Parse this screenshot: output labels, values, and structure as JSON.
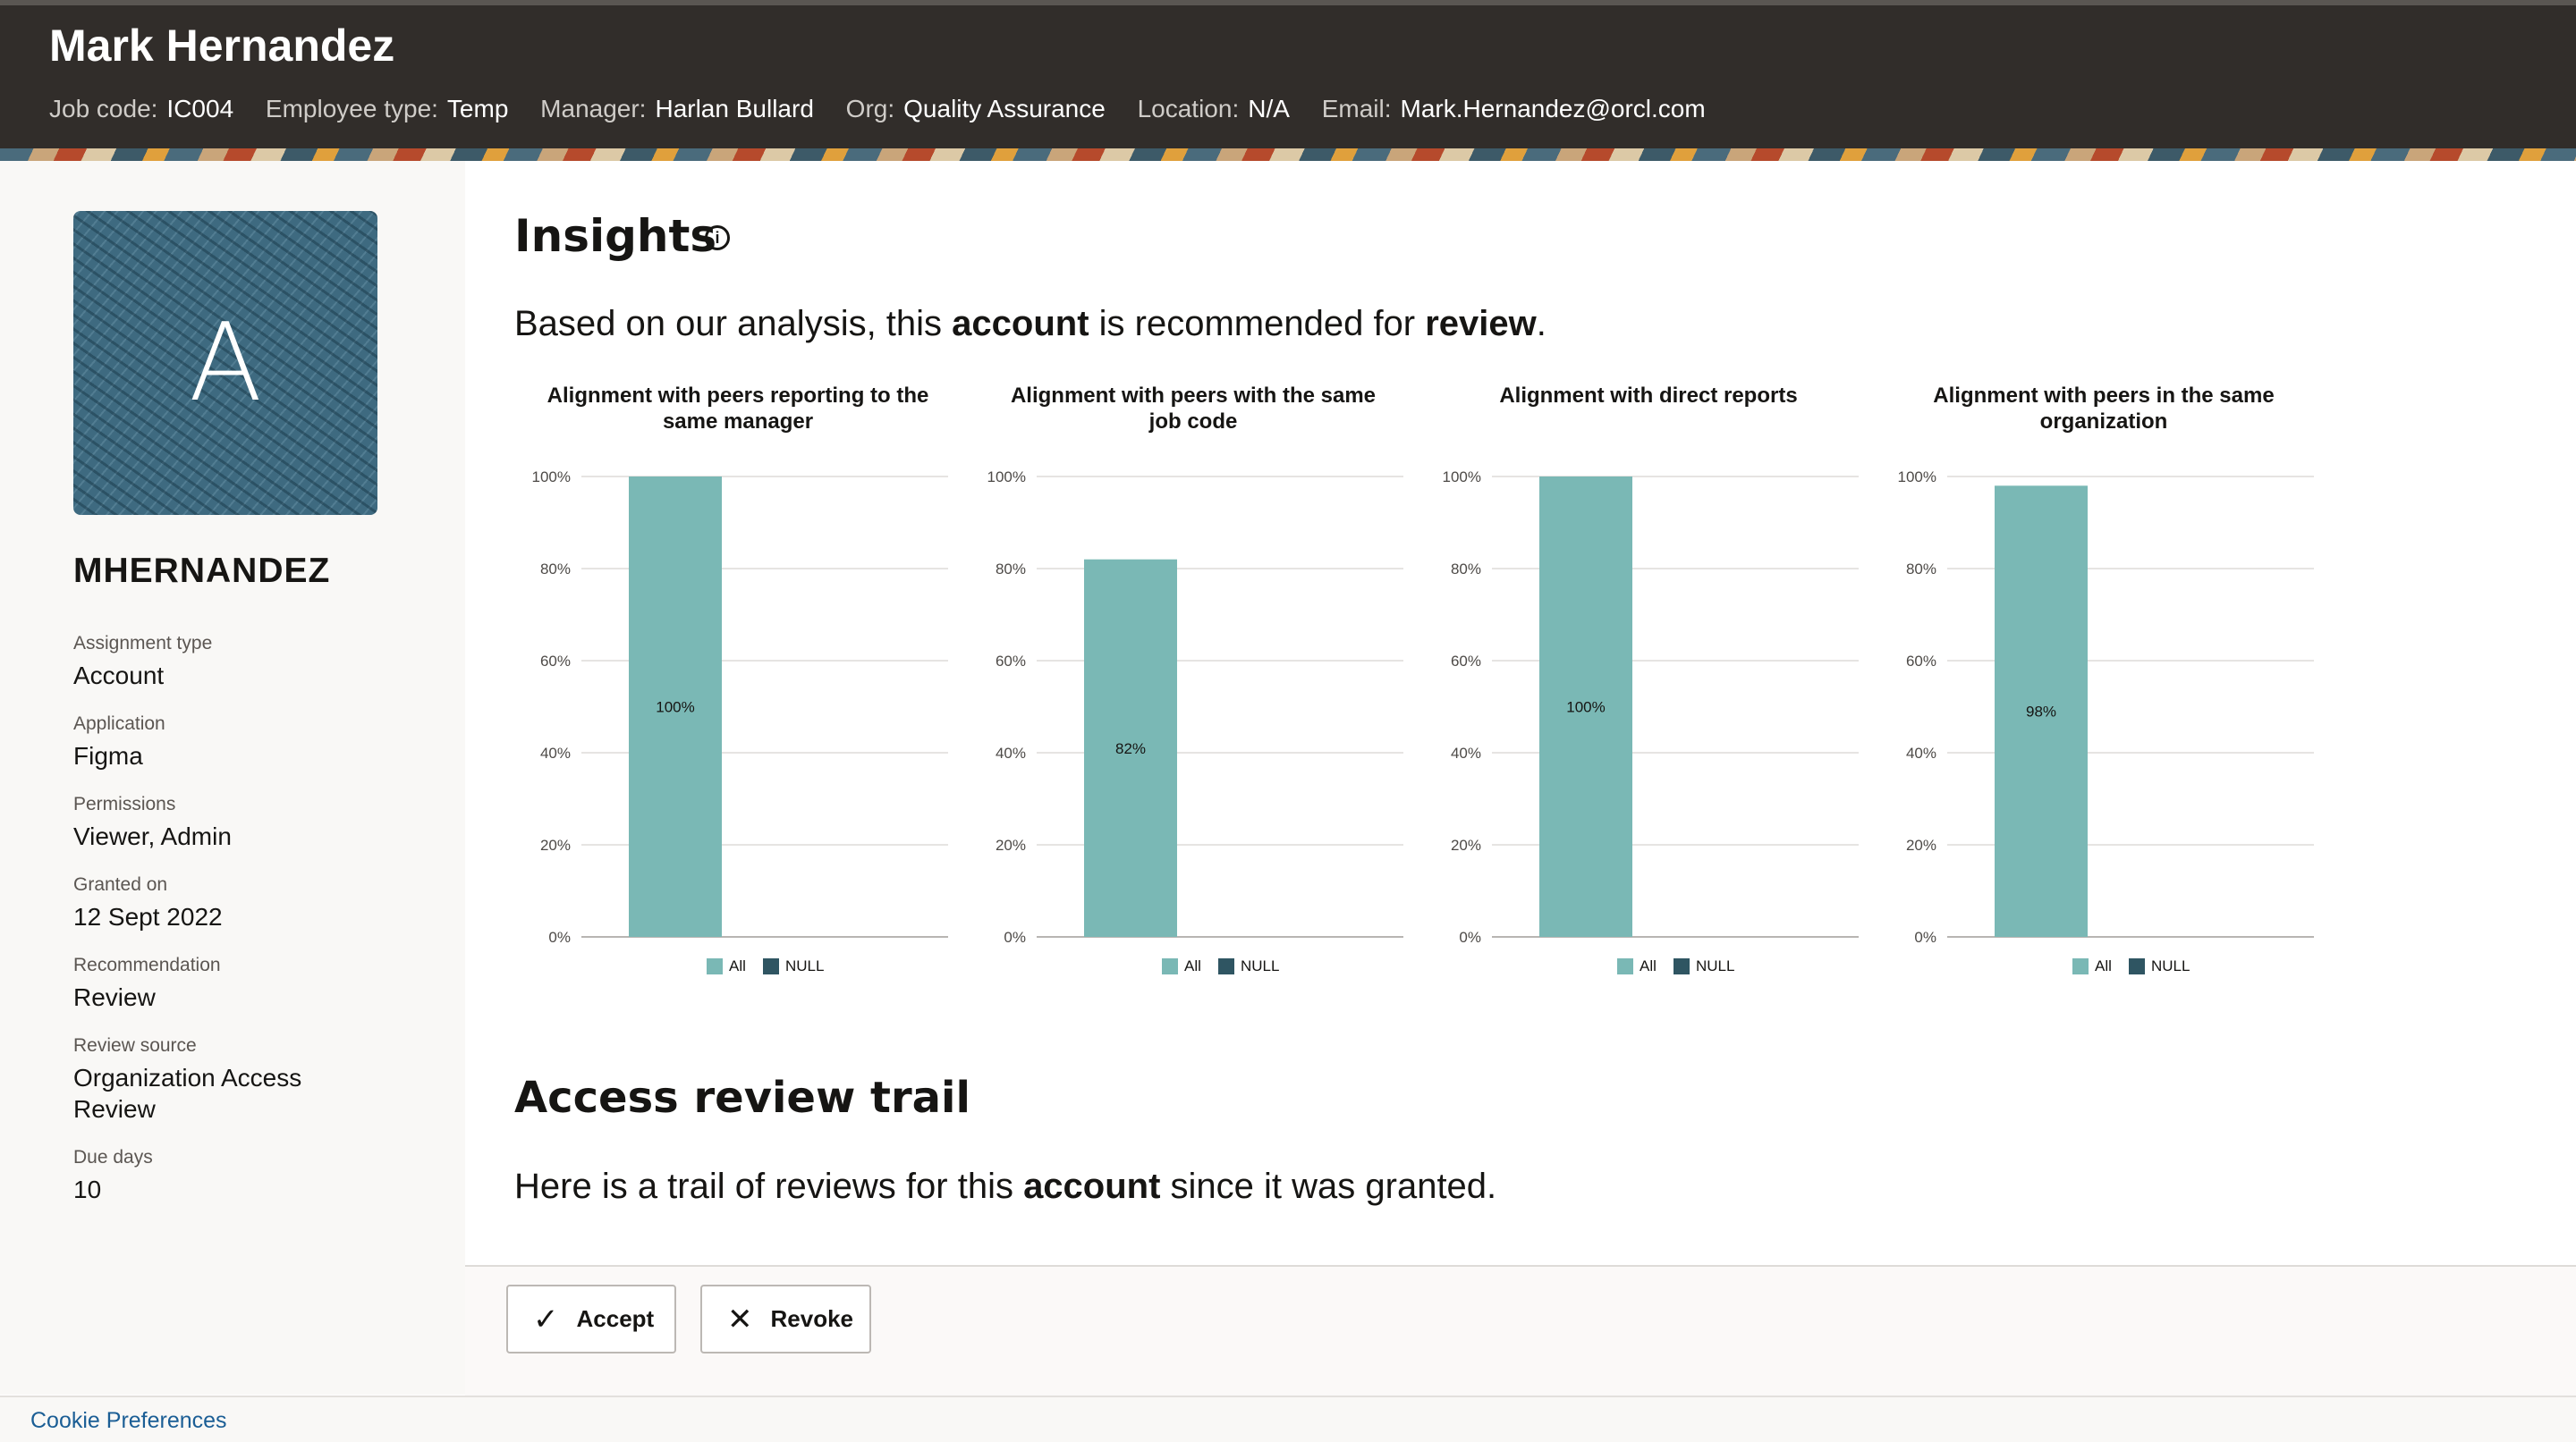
{
  "header": {
    "name": "Mark Hernandez",
    "meta": [
      {
        "key": "Job code:",
        "value": "IC004"
      },
      {
        "key": "Employee type:",
        "value": "Temp"
      },
      {
        "key": "Manager:",
        "value": "Harlan Bullard"
      },
      {
        "key": "Org:",
        "value": "Quality Assurance"
      },
      {
        "key": "Location:",
        "value": "N/A"
      },
      {
        "key": "Email:",
        "value": "Mark.Hernandez@orcl.com"
      }
    ]
  },
  "sidebar": {
    "avatar_letter": "A",
    "username": "MHERNANDEZ",
    "fields": [
      {
        "label": "Assignment type",
        "value": "Account"
      },
      {
        "label": "Application",
        "value": "Figma"
      },
      {
        "label": "Permissions",
        "value": "Viewer, Admin"
      },
      {
        "label": "Granted on",
        "value": "12 Sept 2022"
      },
      {
        "label": "Recommendation",
        "value": "Review"
      },
      {
        "label": "Review source",
        "value": "Organization Access Review"
      },
      {
        "label": "Due days",
        "value": "10"
      }
    ]
  },
  "insights": {
    "title": "Insights",
    "info_icon": "info-icon",
    "sentence": {
      "pre": "Based on our analysis, this ",
      "b1": "account",
      "mid": " is recommended for ",
      "b2": "review",
      "post": "."
    }
  },
  "chart_data": [
    {
      "type": "bar",
      "title": "Alignment with peers reporting to the same manager",
      "categories": [
        ""
      ],
      "series": [
        {
          "name": "All",
          "values": [
            100
          ],
          "label": "100%"
        },
        {
          "name": "NULL",
          "values": [
            0
          ]
        }
      ],
      "yticks": [
        "0%",
        "20%",
        "40%",
        "60%",
        "80%",
        "100%"
      ],
      "ylim": [
        0,
        100
      ],
      "grid": true,
      "legend": "bottom",
      "colors": {
        "All": "#7ab8b5",
        "NULL": "#2f5562"
      }
    },
    {
      "type": "bar",
      "title": "Alignment with peers with the same job code",
      "categories": [
        ""
      ],
      "series": [
        {
          "name": "All",
          "values": [
            82
          ],
          "label": "82%"
        },
        {
          "name": "NULL",
          "values": [
            0
          ]
        }
      ],
      "yticks": [
        "0%",
        "20%",
        "40%",
        "60%",
        "80%",
        "100%"
      ],
      "ylim": [
        0,
        100
      ],
      "grid": true,
      "legend": "bottom",
      "colors": {
        "All": "#7ab8b5",
        "NULL": "#2f5562"
      }
    },
    {
      "type": "bar",
      "title": "Alignment with direct reports",
      "categories": [
        ""
      ],
      "series": [
        {
          "name": "All",
          "values": [
            100
          ],
          "label": "100%"
        },
        {
          "name": "NULL",
          "values": [
            0
          ]
        }
      ],
      "yticks": [
        "0%",
        "20%",
        "40%",
        "60%",
        "80%",
        "100%"
      ],
      "ylim": [
        0,
        100
      ],
      "grid": true,
      "legend": "bottom",
      "colors": {
        "All": "#7ab8b5",
        "NULL": "#2f5562"
      }
    },
    {
      "type": "bar",
      "title": "Alignment with peers in the same organization",
      "categories": [
        ""
      ],
      "series": [
        {
          "name": "All",
          "values": [
            98
          ],
          "label": "98%"
        },
        {
          "name": "NULL",
          "values": [
            0
          ]
        }
      ],
      "yticks": [
        "0%",
        "20%",
        "40%",
        "60%",
        "80%",
        "100%"
      ],
      "ylim": [
        0,
        100
      ],
      "grid": true,
      "legend": "bottom",
      "colors": {
        "All": "#7ab8b5",
        "NULL": "#2f5562"
      }
    }
  ],
  "trail": {
    "title": "Access review trail",
    "sentence": {
      "pre": "Here is a trail of reviews for this ",
      "b1": "account",
      "post": " since it was granted."
    }
  },
  "actions": {
    "accept_label": "Accept",
    "accept_icon": "check-icon",
    "revoke_label": "Revoke",
    "revoke_icon": "close-icon"
  },
  "footer": {
    "cookie_link": "Cookie Preferences"
  }
}
